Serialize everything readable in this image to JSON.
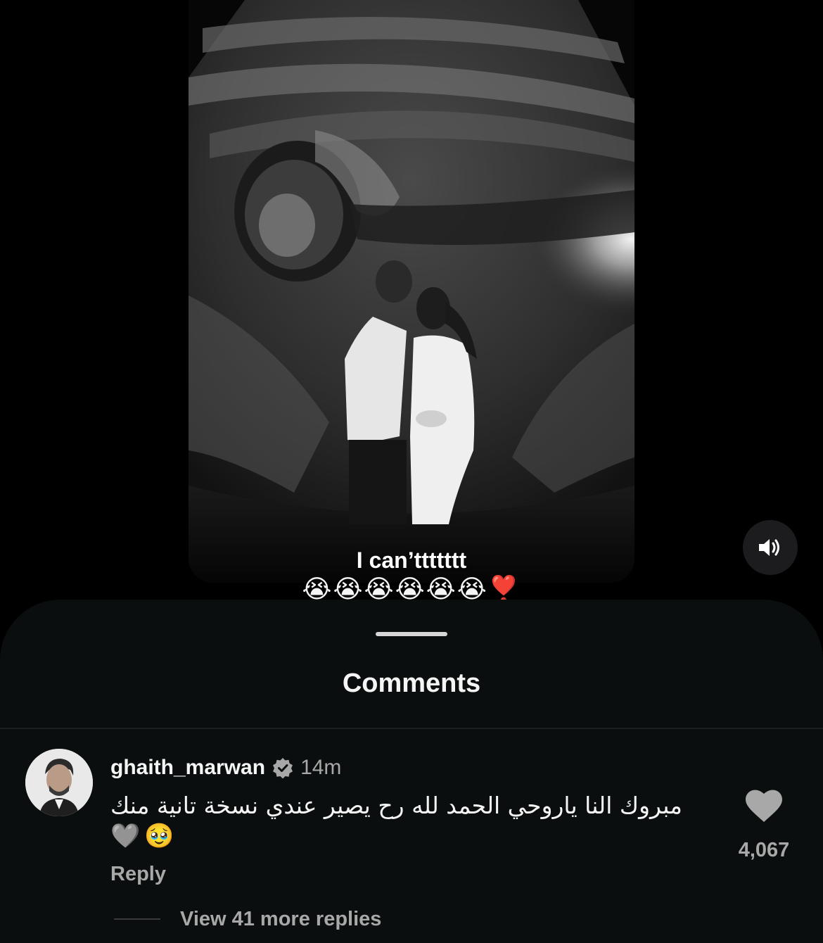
{
  "video": {
    "caption": "I can’ttttttt",
    "caption_emoji": "😭😭😭😭😭😭❣️",
    "sound_icon": "speaker-on-icon"
  },
  "comments_sheet": {
    "title": "Comments",
    "comment": {
      "username": "ghaith_marwan",
      "verified_icon": "verified-badge-icon",
      "timestamp": "14m",
      "text": "مبروك النا ياروحي الحمد لله رح يصير عندي نسخة تانية منك",
      "emoji": [
        "🩶",
        "🥹"
      ],
      "reply_label": "Reply",
      "like_icon": "heart-icon",
      "like_count": "4,067",
      "view_more_replies": "View 41 more replies"
    }
  },
  "colors": {
    "background": "#000000",
    "sheet": "#0b0e0e",
    "primary_text": "#f5f5f5",
    "secondary_text": "#a8a8a8"
  }
}
